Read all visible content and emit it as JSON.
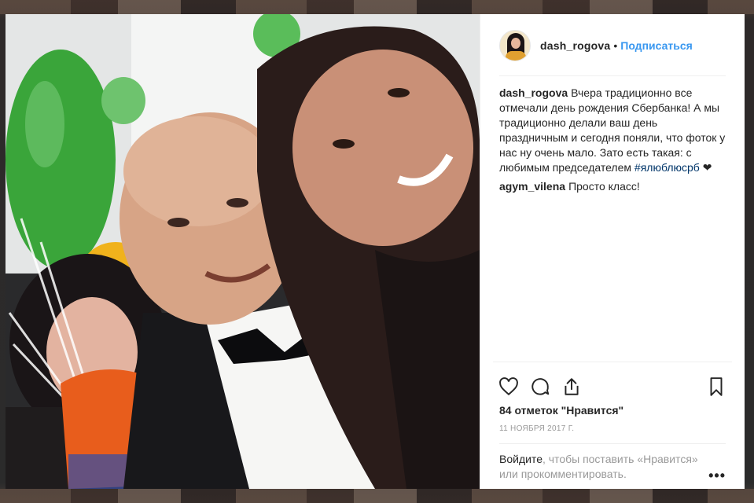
{
  "header": {
    "username": "dash_rogova",
    "separator": "•",
    "follow_label": "Подписаться"
  },
  "comments": [
    {
      "author": "dash_rogova",
      "text": "Вчера традиционно все отмечали день рождения Сбербанка! А мы традиционно делали ваш день праздничным и сегодня поняли, что фоток у нас ну очень мало. Зато есть такая: с любимым председателем",
      "hashtag": "#ялюблюсрб",
      "heart": "❤"
    },
    {
      "author": "agym_vilena",
      "text": "Просто класс!"
    }
  ],
  "actions": {
    "like_icon": "heart-outline-icon",
    "comment_icon": "comment-bubble-icon",
    "share_icon": "share-icon",
    "save_icon": "bookmark-icon"
  },
  "likes": "84 отметок \"Нравится\"",
  "date": "11 ноября 2017 г.",
  "login": {
    "link": "Войдите",
    "text": ", чтобы поставить «Нравится» или прокомментировать.",
    "more": "•••"
  },
  "colors": {
    "link_blue": "#3897f0",
    "hashtag": "#003569",
    "text": "#262626",
    "muted": "#999999"
  }
}
